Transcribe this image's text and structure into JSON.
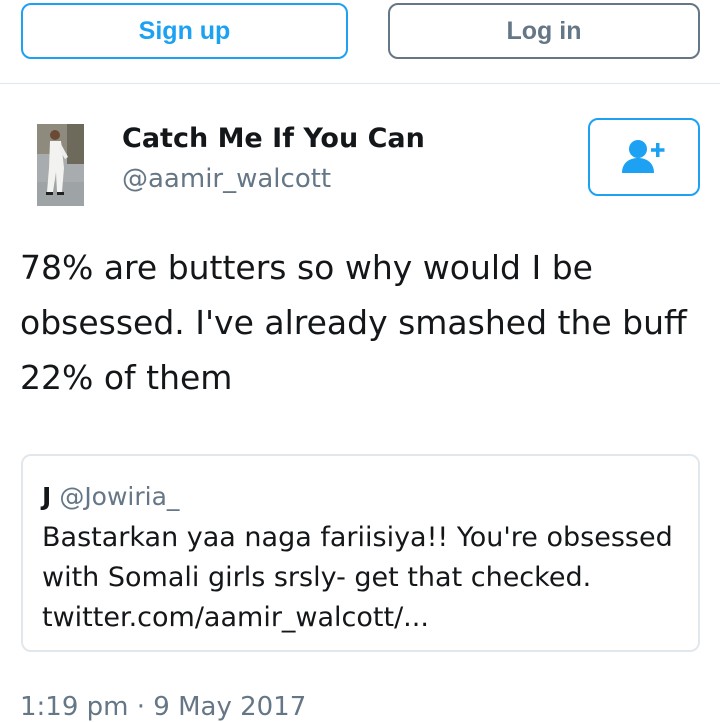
{
  "header": {
    "signup_label": "Sign up",
    "login_label": "Log in"
  },
  "tweet": {
    "author_name": "Catch Me If You Can",
    "author_handle": "@aamir_walcott",
    "text_lines": [
      "78% are butters so why would I be",
      "obsessed. I've already smashed the buff",
      "22% of them"
    ],
    "timestamp": "1:19 pm · 9 May 2017"
  },
  "follow_icon": "follow-user-icon",
  "quoted_tweet": {
    "name": "J",
    "handle": "@Jowiria_",
    "text_lines": [
      "Bastarkan yaa naga fariisiya!! You're obsessed",
      "with Somali girls srsly- get that checked.",
      "twitter.com/aamir_walcott/..."
    ]
  },
  "colors": {
    "accent": "#1da1f2",
    "secondary_text": "#657786",
    "border": "#e1e8ed",
    "text": "#14171a"
  }
}
